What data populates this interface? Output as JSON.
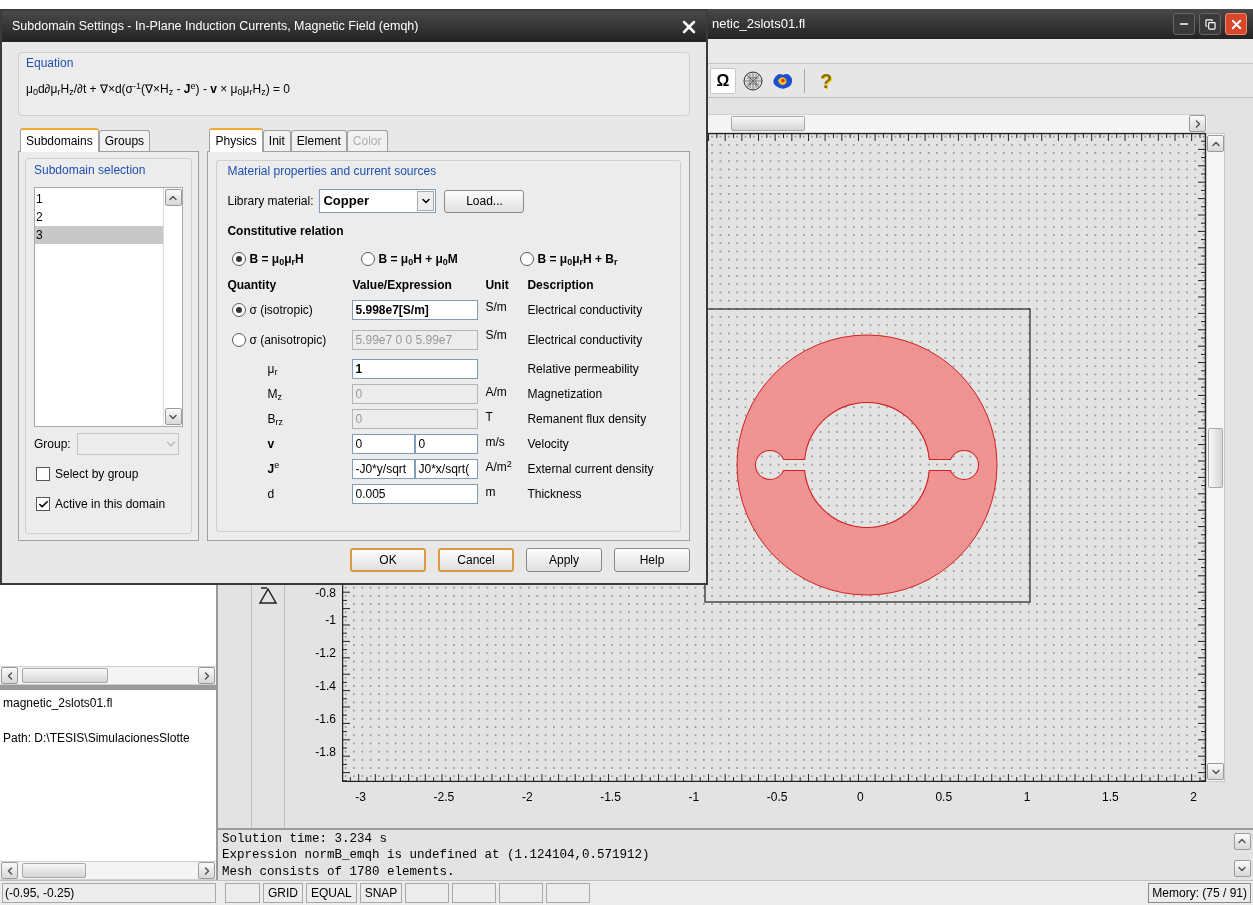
{
  "window": {
    "title": "netic_2slots01.fl"
  },
  "toolbar": [
    {
      "kind": "glyph",
      "text": "Ω",
      "selected": true
    },
    {
      "kind": "mesh",
      "selected": false
    },
    {
      "kind": "plot",
      "selected": false
    },
    {
      "kind": "help",
      "text": "?",
      "selected": false
    }
  ],
  "left_panel": {
    "file_name": "magnetic_2slots01.fl",
    "path": "Path: D:\\TESIS\\SimulacionesSlotte"
  },
  "plot": {
    "x_ticks": [
      "-3",
      "-2.5",
      "-2",
      "-1.5",
      "-1",
      "-0.5",
      "0",
      "0.5",
      "1",
      "1.5",
      "2"
    ],
    "y_ticks": [
      "-0.8",
      "-1",
      "-1.2",
      "-1.4",
      "-1.6",
      "-1.8"
    ]
  },
  "log": [
    "Solution time: 3.234 s",
    "Expression normB_emqh is undefined at (1.124104,0.571912)",
    "Mesh consists of 1780 elements."
  ],
  "status_bar": {
    "coordinates": "(-0.95, -0.25)",
    "toggles": [
      "GRID",
      "EQUAL",
      "SNAP"
    ],
    "memory": "Memory: (75 / 91)"
  },
  "dialog": {
    "title": "Subdomain Settings - In-Plane Induction Currents, Magnetic Field (emqh)",
    "equation": {
      "label": "Equation",
      "text": "μ$_{0}$d∂μ$_{r}$H$_{z}$/∂t + ∇×d(σ$^{-1}$(∇×H$_{z}$ - **J**$^{e}$) - **v** × μ$_{0}$μ$_{r}$H$_{z}$) = 0"
    },
    "left_tabs": [
      {
        "label": "Subdomains",
        "selected": true
      },
      {
        "label": "Groups",
        "selected": false
      }
    ],
    "subdomain_selection": {
      "label": "Subdomain selection",
      "items": [
        {
          "label": "1",
          "selected": false
        },
        {
          "label": "2",
          "selected": false
        },
        {
          "label": "3",
          "selected": true
        }
      ]
    },
    "group": {
      "label": "Group:",
      "disabled": true
    },
    "checkboxes": [
      {
        "label": "Select by group",
        "checked": false
      },
      {
        "label": "Active in this domain",
        "checked": true
      }
    ],
    "right_tabs": [
      {
        "label": "Physics",
        "selected": true,
        "disabled": false
      },
      {
        "label": "Init",
        "selected": false,
        "disabled": false
      },
      {
        "label": "Element",
        "selected": false,
        "disabled": false
      },
      {
        "label": "Color",
        "selected": false,
        "disabled": true
      }
    ],
    "material": {
      "label": "Material properties and current sources",
      "library_label": "Library material:",
      "library_value": "Copper",
      "load_button": "Load..."
    },
    "constitutive": {
      "label": "Constitutive relation",
      "options": [
        {
          "text": "B = μ$_{0}$μ$_{r}$H",
          "selected": true
        },
        {
          "text": "B = μ$_{0}$H + μ$_{0}$M",
          "selected": false
        },
        {
          "text": "B = μ$_{0}$μ$_{r}$H + B$_{r}$",
          "selected": false
        }
      ]
    },
    "columns": [
      "Quantity",
      "Value/Expression",
      "Unit",
      "Description"
    ],
    "rows": [
      {
        "kind": "radio",
        "quantity": "σ (isotropic)",
        "selected": true,
        "fields": [
          {
            "value": "5.998e7[S/m]",
            "bold": true,
            "disabled": false
          }
        ],
        "unit": "S/m",
        "description": "Electrical conductivity"
      },
      {
        "kind": "radio",
        "quantity": "σ (anisotropic)",
        "selected": false,
        "fields": [
          {
            "value": "5.99e7 0 0 5.99e7",
            "bold": false,
            "disabled": true
          }
        ],
        "unit": "S/m",
        "description": "Electrical conductivity"
      },
      {
        "kind": "label",
        "quantity": "μ$_{r}$",
        "fields": [
          {
            "value": "1",
            "bold": true,
            "disabled": false
          }
        ],
        "description": "Relative permeability"
      },
      {
        "kind": "label",
        "quantity": "M$_{z}$",
        "fields": [
          {
            "value": "0",
            "bold": false,
            "disabled": true
          }
        ],
        "unit": "A/m",
        "description": "Magnetization"
      },
      {
        "kind": "label",
        "quantity": "B$_{rz}$",
        "fields": [
          {
            "value": "0",
            "bold": false,
            "disabled": true
          }
        ],
        "unit": "T",
        "description": "Remanent flux density"
      },
      {
        "kind": "label",
        "quantity": "**v**",
        "fields": [
          {
            "value": "0",
            "bold": false,
            "disabled": false
          },
          {
            "value": "0",
            "bold": false,
            "disabled": false
          }
        ],
        "unit": "m/s",
        "description": "Velocity"
      },
      {
        "kind": "label",
        "quantity": "**J**$^{e}$",
        "fields": [
          {
            "value": "-J0*y/sqrt",
            "bold": false,
            "disabled": false
          },
          {
            "value": "J0*x/sqrt(",
            "bold": false,
            "disabled": false
          }
        ],
        "unit": "A/m$^{2}$",
        "description": "External current density"
      },
      {
        "kind": "label",
        "quantity": "d",
        "fields": [
          {
            "value": "0.005",
            "bold": false,
            "disabled": false
          }
        ],
        "unit": "m",
        "description": "Thickness"
      }
    ],
    "buttons": [
      {
        "label": "OK",
        "focused": true
      },
      {
        "label": "Cancel",
        "focused": true
      },
      {
        "label": "Apply",
        "focused": false
      },
      {
        "label": "Help",
        "focused": false
      }
    ]
  }
}
